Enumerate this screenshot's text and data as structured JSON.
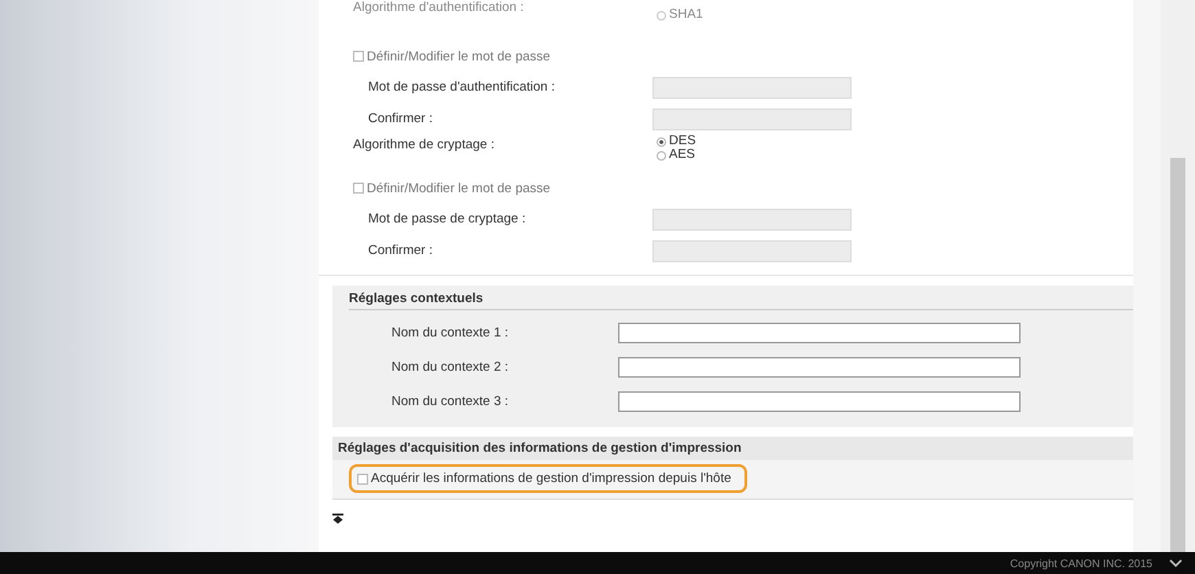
{
  "auth_algorithm": {
    "label": "Algorithme d'authentification :",
    "options": [
      {
        "label": "SHA1",
        "selected": false
      }
    ]
  },
  "auth_password": {
    "checkbox": {
      "label": "Définir/Modifier le mot de passe",
      "checked": false
    },
    "fields": [
      {
        "label": "Mot de passe d'authentification :",
        "disabled": true
      },
      {
        "label": "Confirmer :",
        "disabled": true
      }
    ]
  },
  "encryption_algorithm": {
    "label": "Algorithme de cryptage :",
    "options": [
      {
        "label": "DES",
        "selected": true
      },
      {
        "label": "AES",
        "selected": false
      }
    ]
  },
  "encryption_password": {
    "checkbox": {
      "label": "Définir/Modifier le mot de passe",
      "checked": false
    },
    "fields": [
      {
        "label": "Mot de passe de cryptage :",
        "disabled": true
      },
      {
        "label": "Confirmer :",
        "disabled": true
      }
    ]
  },
  "context_settings": {
    "title": "Réglages contextuels",
    "fields": [
      {
        "label": "Nom du contexte 1 :",
        "disabled": false
      },
      {
        "label": "Nom du contexte 2 :",
        "disabled": false
      },
      {
        "label": "Nom du contexte 3 :",
        "disabled": false
      }
    ]
  },
  "print_management": {
    "title": "Réglages d'acquisition des informations de gestion d'impression",
    "checkbox": {
      "label": "Acquérir les informations de gestion d'impression depuis l'hôte",
      "checked": false,
      "highlighted": true
    }
  },
  "footer": {
    "copyright": "Copyright CANON INC. 2015"
  }
}
